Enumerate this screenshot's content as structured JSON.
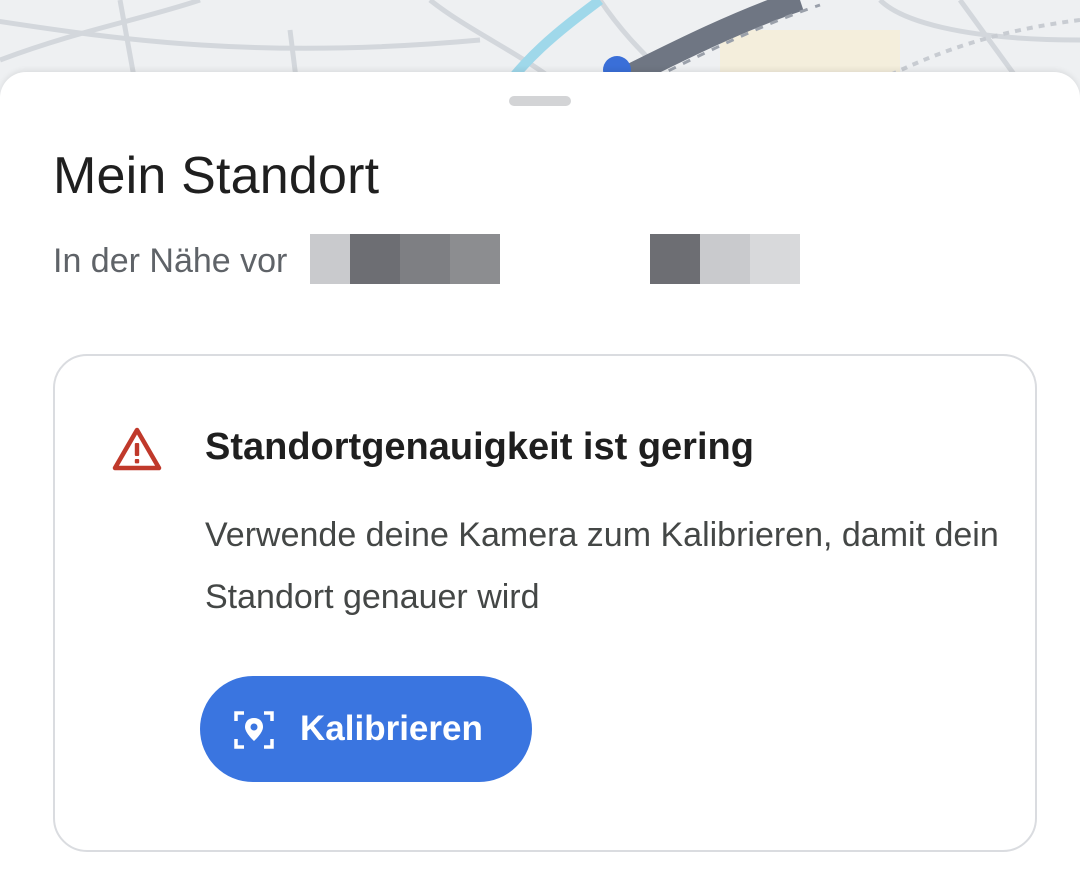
{
  "sheet": {
    "title": "Mein Standort",
    "subtitle": "In der Nähe vor"
  },
  "warning_card": {
    "icon": "warning-triangle-icon",
    "title": "Standortgenauigkeit ist gering",
    "body": "Verwende deine Kamera zum Kalibrieren, damit dein Standort genauer wird",
    "button": {
      "label": "Kalibrieren",
      "icon": "location-scan-icon"
    }
  },
  "colors": {
    "accent": "#3a75e0",
    "warning": "#c0392b",
    "title_text": "#1f1f1f",
    "secondary_text": "#5f6368"
  }
}
